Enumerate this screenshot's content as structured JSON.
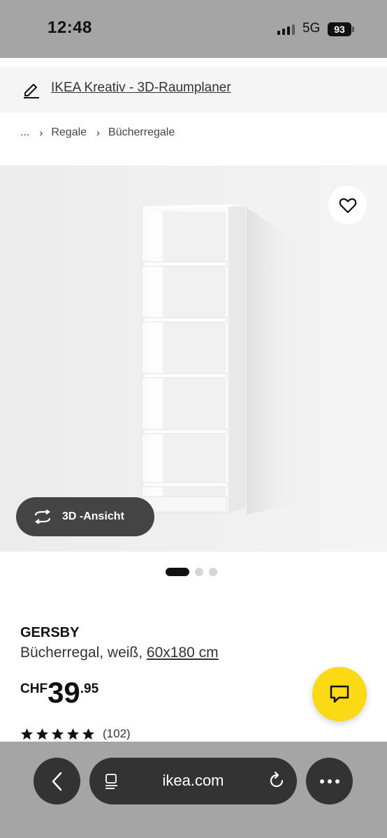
{
  "status_bar": {
    "time": "12:48",
    "network": "5G",
    "battery": "93"
  },
  "kreativ_banner": {
    "link_label": "IKEA Kreativ - 3D-Raumplaner",
    "icon": "pencil-icon"
  },
  "breadcrumb": {
    "ellipsis": "...",
    "items": [
      "Regale",
      "Bücherregale"
    ]
  },
  "gallery": {
    "view_3d_label": "3D -Ansicht",
    "active_slide": 1,
    "total_slides": 3
  },
  "product": {
    "name": "GERSBY",
    "description": "Bücherregal, weiß,",
    "dimension_link": "60x180 cm",
    "price": {
      "currency": "CHF",
      "integer": "39",
      "decimal": ".95"
    },
    "rating": {
      "stars": 5,
      "count": "(102)"
    }
  },
  "browser": {
    "url": "ikea.com"
  },
  "colors": {
    "accent_yellow": "#fbd914",
    "dark": "#111111",
    "system_gray": "#a5a5a5"
  }
}
